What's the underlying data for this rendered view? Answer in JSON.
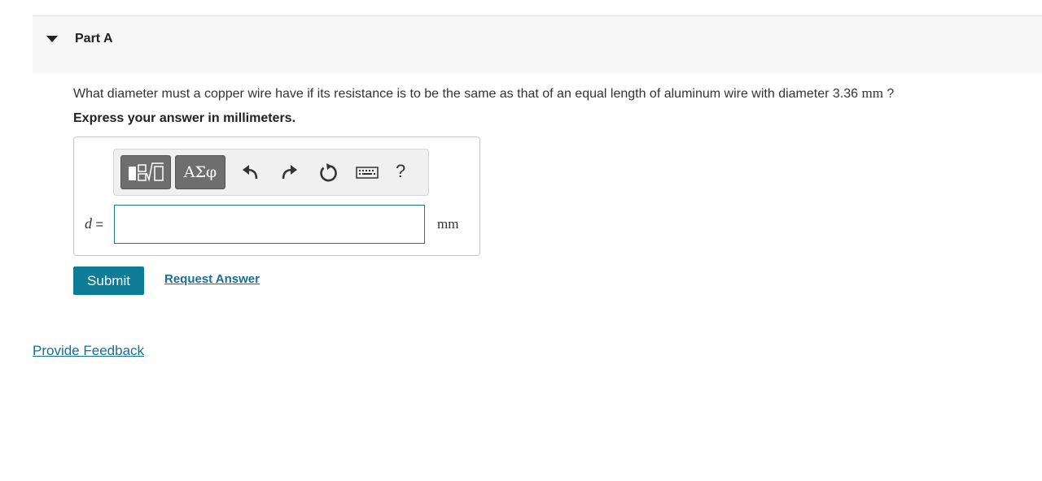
{
  "part": {
    "title": "Part A",
    "caret_icon": "triangle-down-icon"
  },
  "question": {
    "text_before_unit": "What diameter must a copper wire have if its resistance is to be the same as that of an equal length of aluminum wire with diameter 3.36 ",
    "unit": "mm",
    "text_after_unit": " ?",
    "instruction": "Express your answer in millimeters."
  },
  "toolbar": {
    "greek_label": "ΑΣφ",
    "help_label": "?",
    "icons": [
      "templates-icon",
      "undo-icon",
      "redo-icon",
      "reset-icon",
      "keyboard-icon",
      "help-icon"
    ]
  },
  "answer": {
    "variable": "d",
    "equals": " =",
    "value": "",
    "unit": "mm"
  },
  "actions": {
    "submit_label": "Submit",
    "request_answer_label": "Request Answer"
  },
  "footer": {
    "feedback_label": "Provide Feedback"
  },
  "colors": {
    "accent": "#0e7c96",
    "link": "#1a6e94",
    "input_border": "#1a7a8c"
  }
}
